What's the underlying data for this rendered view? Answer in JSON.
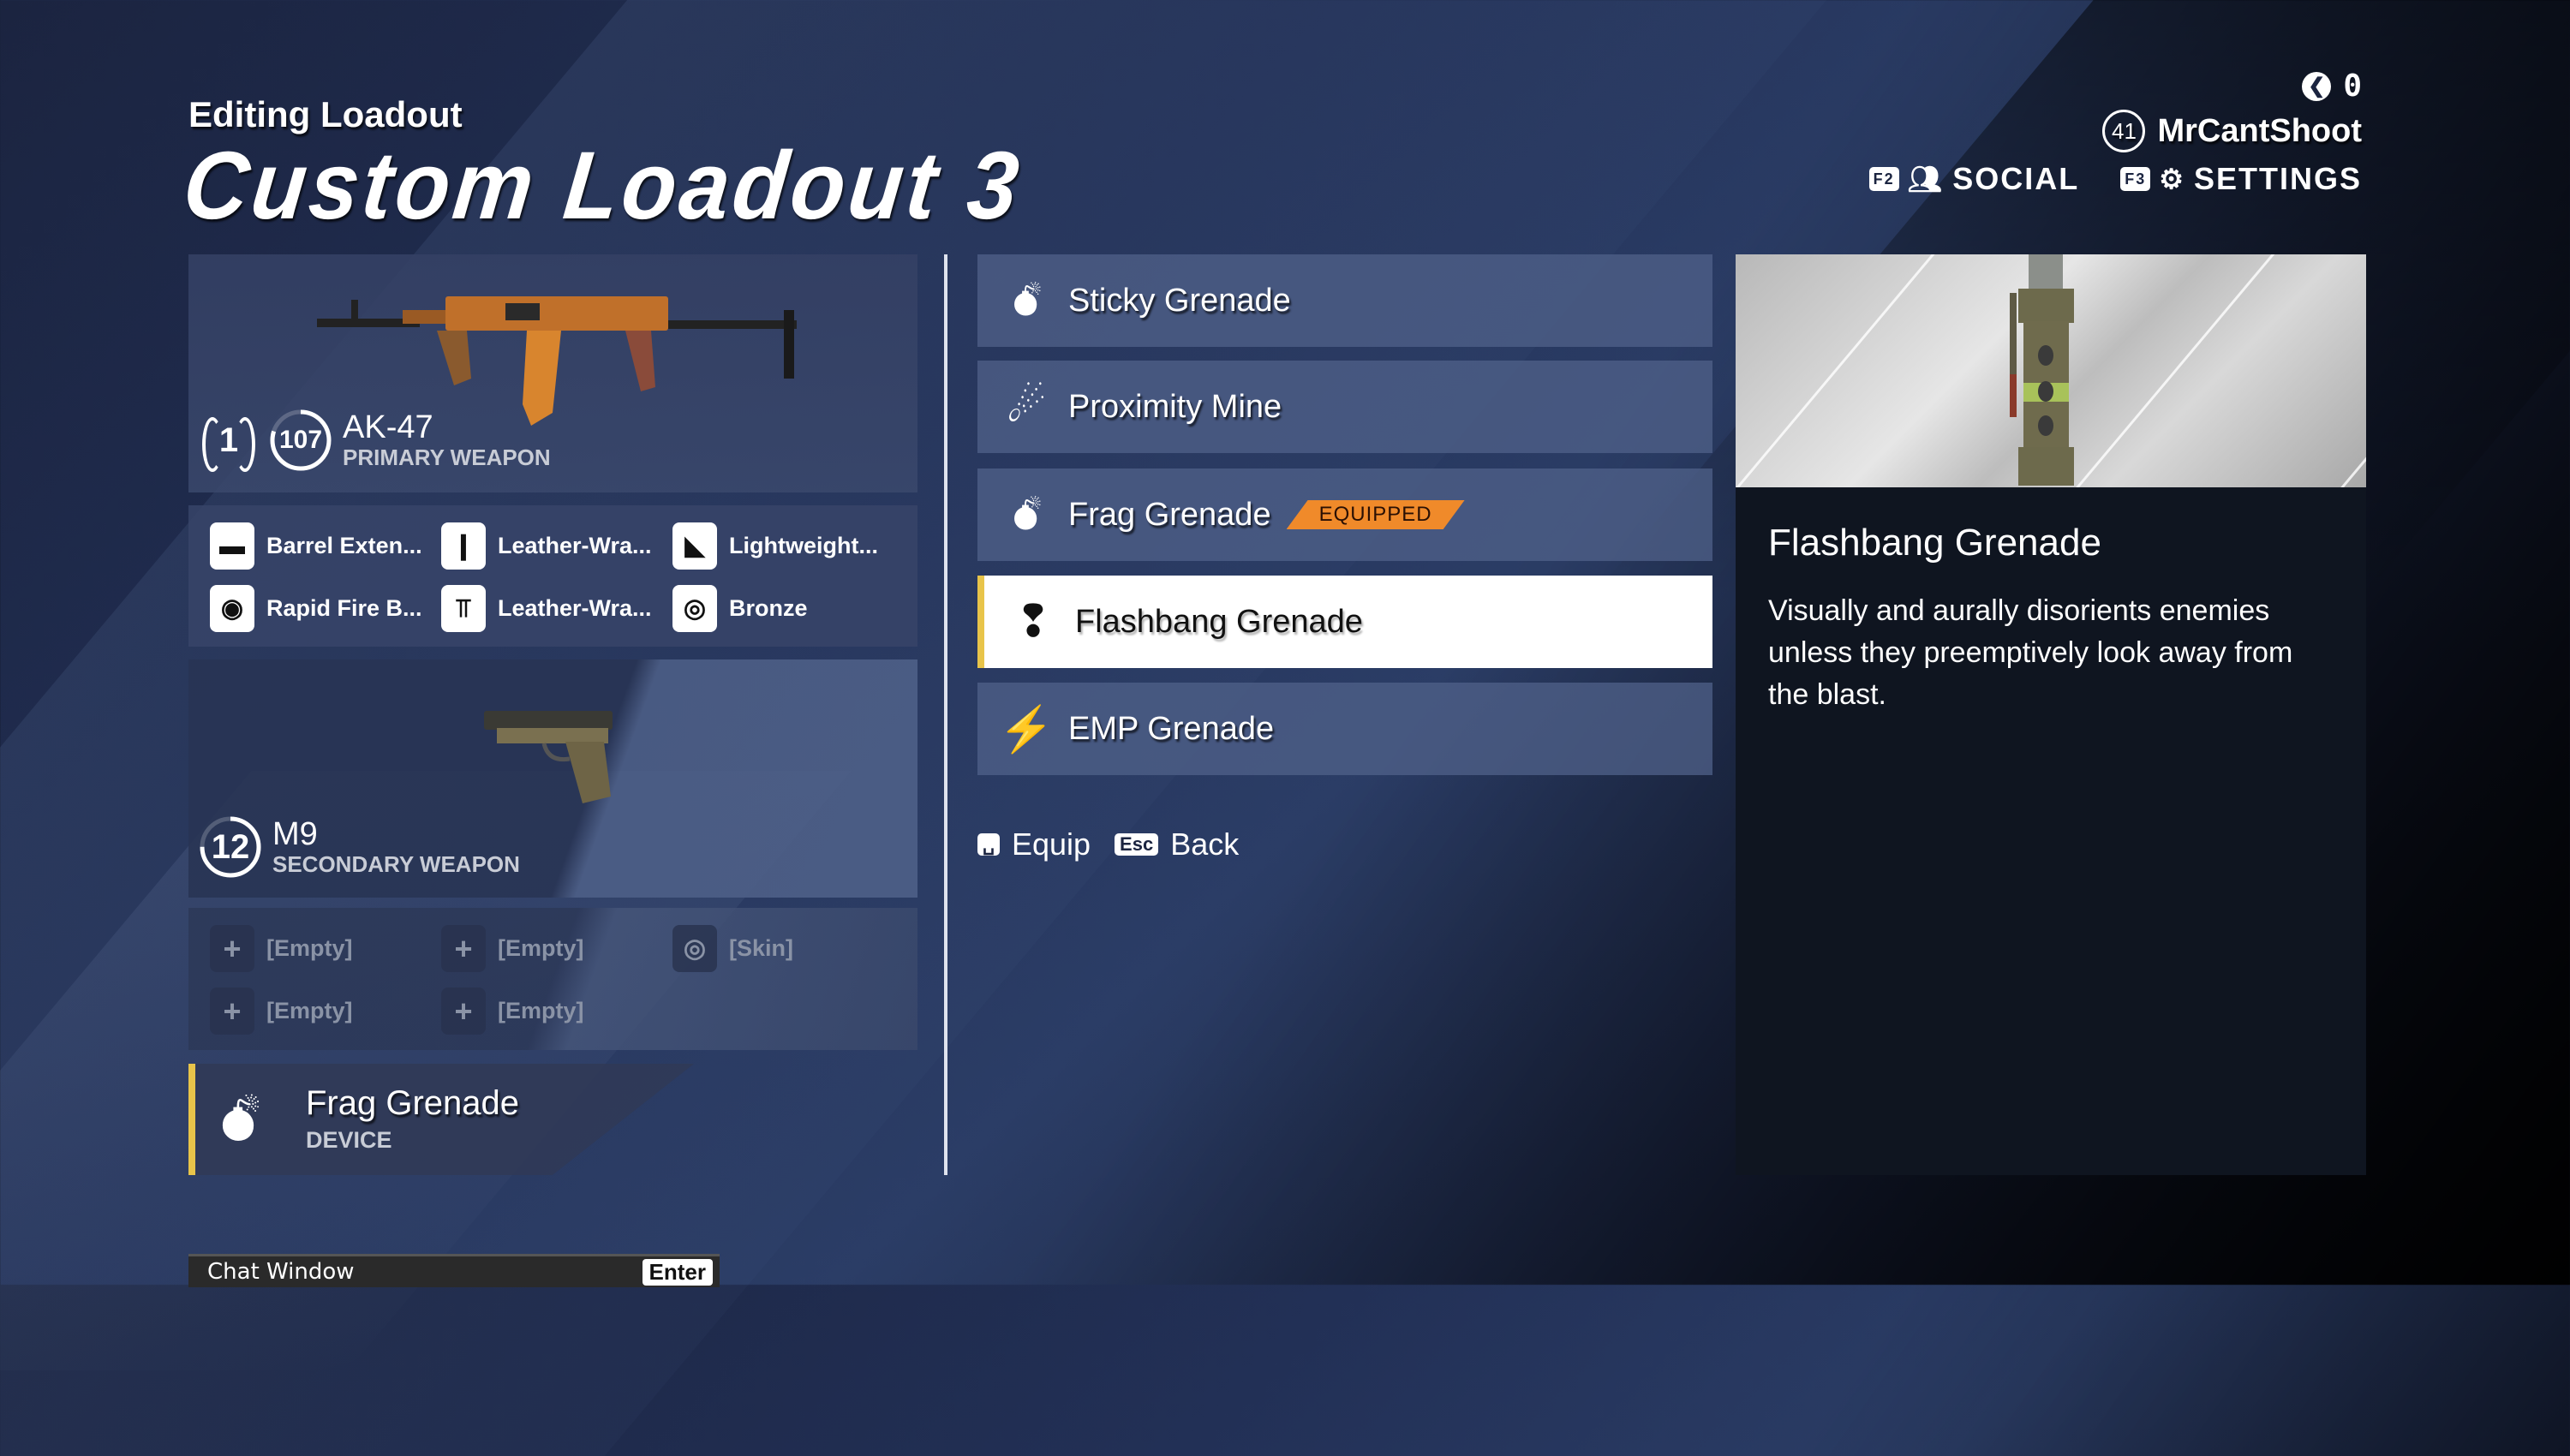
{
  "header": {
    "subtitle": "Editing Loadout",
    "title": "Custom Loadout 3"
  },
  "top_right": {
    "currency_icon": "xp-token-icon",
    "currency_value": "0",
    "player_level": "41",
    "player_name": "MrCantShoot",
    "nav": [
      {
        "key": "F2",
        "icon": "social-icon",
        "label": "SOCIAL"
      },
      {
        "key": "F3",
        "icon": "gear-icon",
        "label": "SETTINGS"
      }
    ]
  },
  "primary": {
    "prestige": "1",
    "level": "107",
    "level_progress": 0.8,
    "name": "AK-47",
    "type": "PRIMARY WEAPON",
    "attachments": [
      {
        "icon": "muzzle-icon",
        "label": "Barrel Exten..."
      },
      {
        "icon": "foregrip-icon",
        "label": "Leather-Wra..."
      },
      {
        "icon": "stock-icon",
        "label": "Lightweight..."
      },
      {
        "icon": "ammo-icon",
        "label": "Rapid Fire B..."
      },
      {
        "icon": "grip-icon",
        "label": "Leather-Wra..."
      },
      {
        "icon": "skin-icon",
        "label": "Bronze"
      }
    ]
  },
  "secondary": {
    "level": "12",
    "level_progress": 0.75,
    "name": "M9",
    "type": "SECONDARY WEAPON",
    "attachments": [
      {
        "icon": "plus-icon",
        "label": "[Empty]"
      },
      {
        "icon": "plus-icon",
        "label": "[Empty]"
      },
      {
        "icon": "skin-icon",
        "label": "[Skin]"
      },
      {
        "icon": "plus-icon",
        "label": "[Empty]"
      },
      {
        "icon": "plus-icon",
        "label": "[Empty]"
      }
    ]
  },
  "device": {
    "name": "Frag Grenade",
    "type": "DEVICE"
  },
  "device_list": [
    {
      "icon": "sticky-grenade-icon",
      "label": "Sticky Grenade",
      "equipped": false,
      "selected": false
    },
    {
      "icon": "proximity-mine-icon",
      "label": "Proximity Mine",
      "equipped": false,
      "selected": false
    },
    {
      "icon": "frag-grenade-icon",
      "label": "Frag Grenade",
      "equipped": true,
      "selected": false
    },
    {
      "icon": "flashbang-grenade-icon",
      "label": "Flashbang Grenade",
      "equipped": false,
      "selected": true
    },
    {
      "icon": "emp-grenade-icon",
      "label": "EMP Grenade",
      "equipped": false,
      "selected": false
    }
  ],
  "equipped_tag": "EQUIPPED",
  "hints": [
    {
      "key": "␣",
      "label": "Equip"
    },
    {
      "key": "Esc",
      "label": "Back"
    }
  ],
  "detail": {
    "title": "Flashbang Grenade",
    "description": "Visually and aurally disorients enemies unless they preemptively look away from the blast."
  },
  "chat": {
    "label": "Chat Window",
    "key": "Enter"
  },
  "colors": {
    "accent_gold": "#e8c44a",
    "equipped_orange": "#f08a2a",
    "selected_bg": "#ffffff"
  }
}
